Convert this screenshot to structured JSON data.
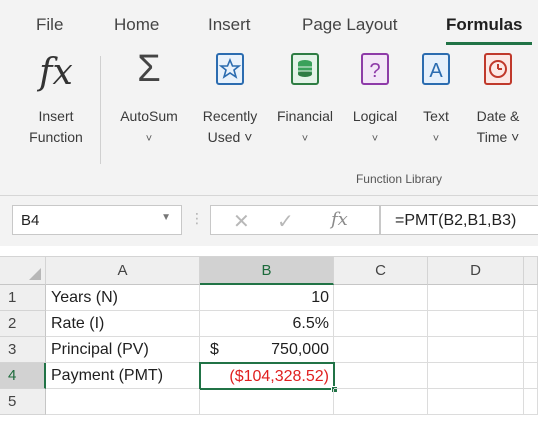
{
  "ribbon": {
    "tabs": [
      "File",
      "Home",
      "Insert",
      "Page Layout",
      "Formulas"
    ],
    "active_tab": "Formulas",
    "group_title": "Function Library",
    "buttons": {
      "insert_function": {
        "line1": "Insert",
        "line2": "Function",
        "icon": "fx-icon"
      },
      "autosum": {
        "line1": "AutoSum",
        "line2": "˅",
        "icon": "sigma-icon"
      },
      "recently_used": {
        "line1": "Recently",
        "line2": "Used ˅",
        "icon": "star-book-icon"
      },
      "financial": {
        "line1": "Financial",
        "line2": "˅",
        "icon": "coins-book-icon"
      },
      "logical": {
        "line1": "Logical",
        "line2": "˅",
        "icon": "question-book-icon"
      },
      "text": {
        "line1": "Text",
        "line2": "˅",
        "icon": "text-book-icon"
      },
      "date_time": {
        "line1": "Date &",
        "line2": "Time ˅",
        "icon": "clock-book-icon"
      }
    },
    "accent_color": "#217346"
  },
  "formula_bar": {
    "name_box": "B4",
    "formula": "=PMT(B2,B1,B3)",
    "fx_label": "fx"
  },
  "grid": {
    "columns": [
      "A",
      "B",
      "C",
      "D"
    ],
    "rows": [
      "1",
      "2",
      "3",
      "4",
      "5"
    ],
    "cells": {
      "A1": "Years (N)",
      "B1": "10",
      "A2": "Rate (I)",
      "B2": "6.5%",
      "A3": "Principal (PV)",
      "B3_currency": "$",
      "B3": "750,000",
      "A4": "Payment (PMT)",
      "B4": "($104,328.52)"
    },
    "selected_cell": "B4",
    "negative_color": "#e02020"
  }
}
